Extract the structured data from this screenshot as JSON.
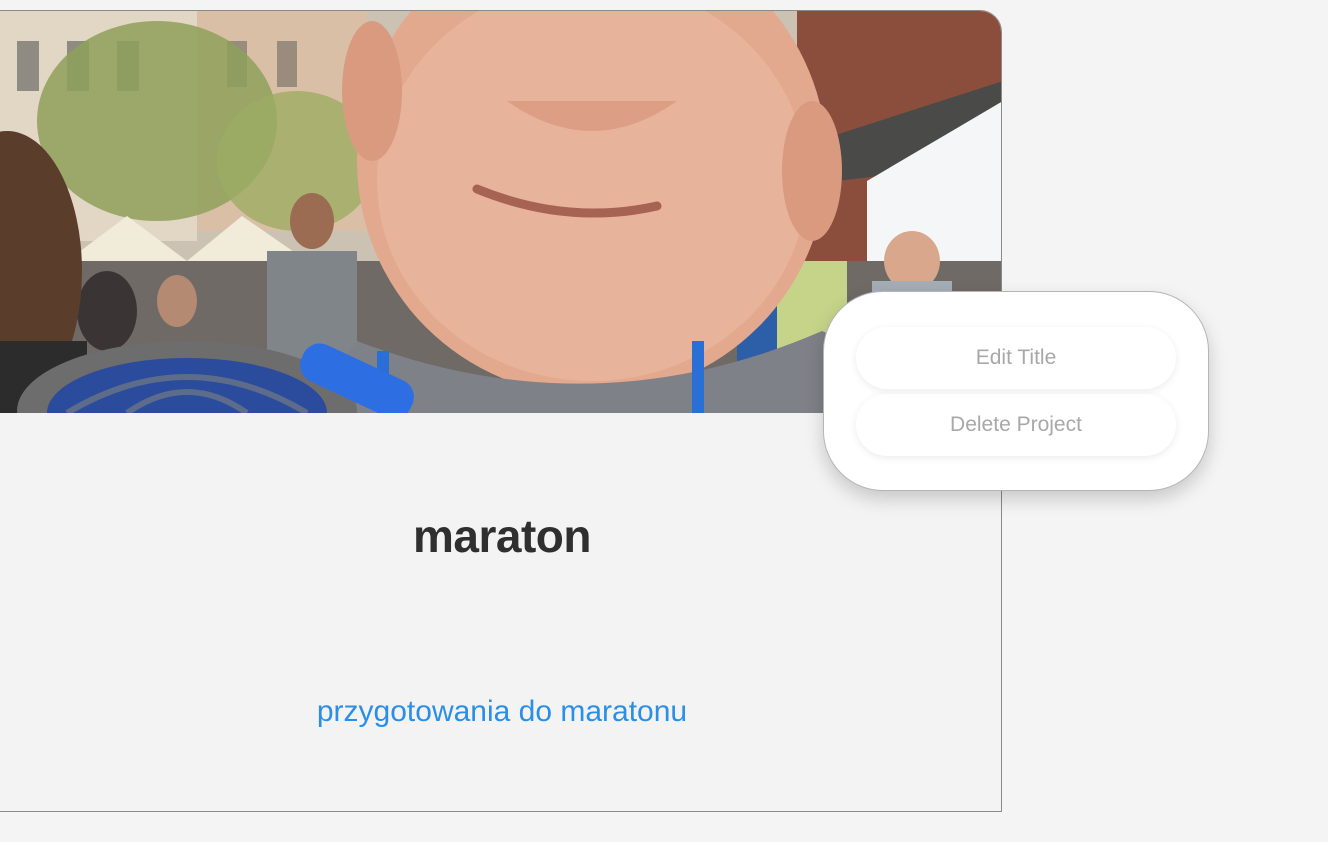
{
  "project": {
    "title": "maraton",
    "description_link": "przygotowania do maratonu",
    "cover_image": "portrait-photo-city-square"
  },
  "context_menu": {
    "edit_title_label": "Edit Title",
    "delete_project_label": "Delete Project"
  },
  "colors": {
    "page_background": "#f4f4f4",
    "card_background": "#f3f3f3",
    "title_text": "#2f2f2f",
    "link": "#2b8fe8",
    "menu_text": "#a8a8a8"
  }
}
